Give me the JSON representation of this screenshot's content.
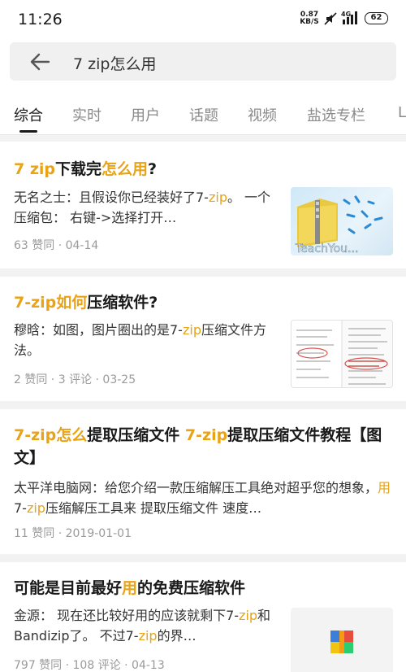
{
  "status_bar": {
    "time": "11:26",
    "net_speed_value": "0.87",
    "net_speed_unit": "KB/S",
    "network": "4G",
    "battery": "62"
  },
  "search": {
    "query": "7 zip怎么用"
  },
  "tabs": [
    "综合",
    "实时",
    "用户",
    "话题",
    "视频",
    "盐选专栏",
    "L"
  ],
  "results": [
    {
      "title": [
        [
          "7 zip",
          true
        ],
        [
          "下载完",
          false
        ],
        [
          "怎么用",
          true
        ],
        [
          "?",
          false
        ]
      ],
      "body": [
        [
          "无名之士：且假设你已经装好了7-",
          false
        ],
        [
          "zip",
          true
        ],
        [
          "。 一个压缩包： 右键->选择打开…",
          false
        ]
      ],
      "meta": "63 赞同 · 04-14",
      "thumb_caption": "TeachYou..."
    },
    {
      "title": [
        [
          "7-",
          true
        ],
        [
          "zip",
          true
        ],
        [
          "如何",
          true
        ],
        [
          "压缩软件?",
          false
        ]
      ],
      "body": [
        [
          "穆晗：如图，图片圈出的是7-",
          false
        ],
        [
          "zip",
          true
        ],
        [
          "压缩文件方法。",
          false
        ]
      ],
      "meta": "2 赞同 · 3 评论 · 03-25"
    },
    {
      "title": [
        [
          "7-",
          true
        ],
        [
          "zip",
          true
        ],
        [
          "怎么",
          true
        ],
        [
          "提取压缩文件 ",
          false
        ],
        [
          "7-",
          true
        ],
        [
          "zip",
          true
        ],
        [
          "提取压缩文件教程【图文】",
          false
        ]
      ],
      "body": [
        [
          "太平洋电脑网：给您介绍一款压缩解压工具绝对超乎您的想象，",
          false
        ],
        [
          "用",
          true
        ],
        [
          "7-",
          false
        ],
        [
          "zip",
          true
        ],
        [
          "压缩解压工具来 提取压缩文件 速度…",
          false
        ]
      ],
      "meta": "11 赞同 · 2019-01-01"
    },
    {
      "title": [
        [
          "可能是目前最好",
          false
        ],
        [
          "用",
          true
        ],
        [
          "的免费压缩软件",
          false
        ]
      ],
      "body": [
        [
          "金源： 现在还比较好用的应该就剩下7-",
          false
        ],
        [
          "zip",
          true
        ],
        [
          "和Bandizip了。 不过7-",
          false
        ],
        [
          "zip",
          true
        ],
        [
          "的界…",
          false
        ]
      ],
      "meta": "797 赞同 · 108 评论 · 04-13"
    }
  ],
  "colors": {
    "highlight": "#e8a317",
    "text": "#1a1a1a",
    "meta": "#9a9a9a"
  }
}
